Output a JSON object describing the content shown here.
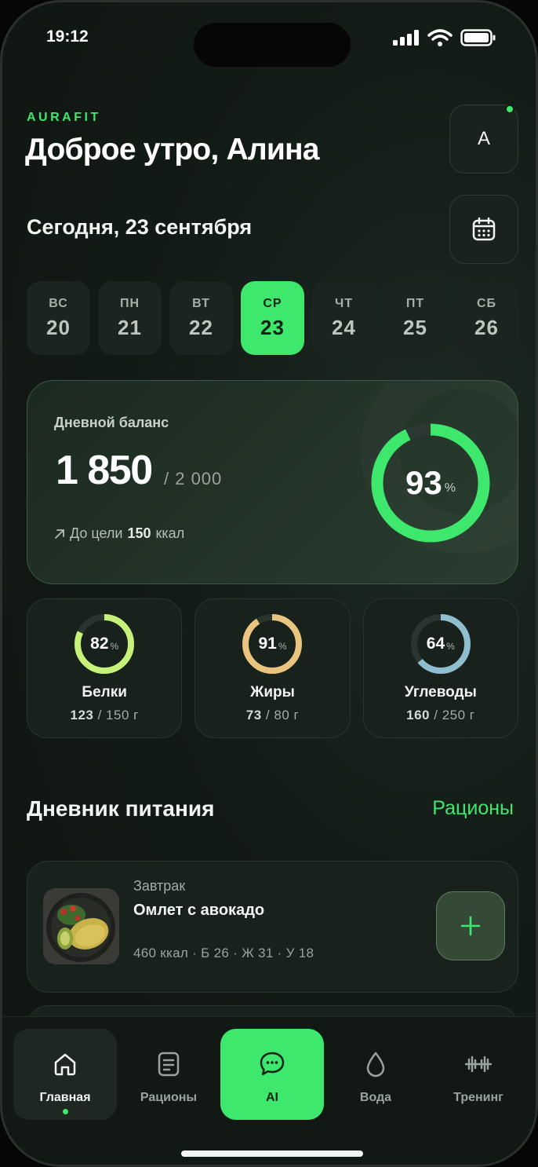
{
  "status_bar": {
    "time": "19:12"
  },
  "header": {
    "brand": "AURAFIT",
    "greeting": "Доброе утро, Алина",
    "avatar_initial": "A",
    "date_label": "Сегодня, 23 сентября"
  },
  "week": [
    {
      "dow": "ВС",
      "num": "20",
      "active": false
    },
    {
      "dow": "ПН",
      "num": "21",
      "active": false
    },
    {
      "dow": "ВТ",
      "num": "22",
      "active": false
    },
    {
      "dow": "СР",
      "num": "23",
      "active": true
    },
    {
      "dow": "ЧТ",
      "num": "24",
      "active": false
    },
    {
      "dow": "ПТ",
      "num": "25",
      "active": false
    },
    {
      "dow": "СБ",
      "num": "26",
      "active": false
    }
  ],
  "balance": {
    "label": "Дневной баланс",
    "value": "1 850",
    "goal": "/ 2 000",
    "note_prefix": "До цели",
    "note_value": "150",
    "note_unit": "ккал",
    "percent": "93",
    "percent_sign": "%",
    "progress": 0.93
  },
  "macros": [
    {
      "name": "Белки",
      "percent": "82",
      "sign": "%",
      "progress": 0.82,
      "current": "123",
      "total": "/ 150 г",
      "color": "#c6f27a"
    },
    {
      "name": "Жиры",
      "percent": "91",
      "sign": "%",
      "progress": 0.91,
      "current": "73",
      "total": "/ 80 г",
      "color": "#e8c47f"
    },
    {
      "name": "Углеводы",
      "percent": "64",
      "sign": "%",
      "progress": 0.64,
      "current": "160",
      "total": "/ 250 г",
      "color": "#8fbfcf"
    }
  ],
  "diary": {
    "title": "Дневник питания",
    "link": "Рационы",
    "meals": [
      {
        "type": "Завтрак",
        "name": "Омлет с авокадо",
        "macros": "460 ккал · Б 26 · Ж 31 · У 18"
      }
    ]
  },
  "tabs": [
    {
      "label": "Главная",
      "icon": "home-icon",
      "active": true
    },
    {
      "label": "Рационы",
      "icon": "document-icon",
      "active": false
    },
    {
      "label": "AI",
      "icon": "chat-icon",
      "active": false
    },
    {
      "label": "Вода",
      "icon": "drop-icon",
      "active": false
    },
    {
      "label": "Тренинг",
      "icon": "dumbbell-icon",
      "active": false
    }
  ],
  "colors": {
    "accent": "#3ee86d",
    "background": "#131b17",
    "card": "#18211c"
  }
}
